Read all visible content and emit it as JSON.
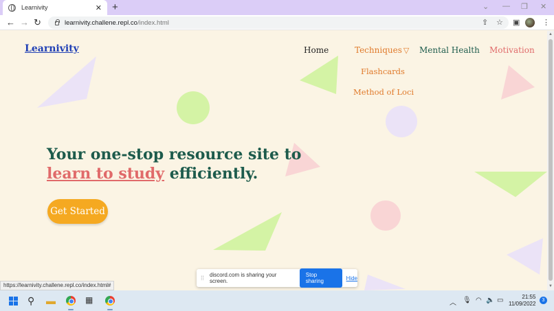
{
  "browser": {
    "tab_title": "Learnivity",
    "url_host": "learnivity.challene.repl.co",
    "url_path": "/index.html",
    "close_glyph": "✕",
    "new_tab_glyph": "+"
  },
  "site": {
    "logo": "Learnivity",
    "nav": {
      "home": "Home",
      "techniques": "Techniques",
      "mental_health": "Mental Health",
      "motivation": "Motivation"
    },
    "dropdown": [
      "Flashcards",
      "Method of Loci"
    ],
    "hero": {
      "line1": "Your one-stop resource site to",
      "highlight": "learn to study",
      "line2_rest": " efficiently."
    },
    "cta": "Get Started"
  },
  "status_bar": {
    "link": "https://learnivity.challene.repl.co/index.html#"
  },
  "share_bar": {
    "message": "discord.com is sharing your screen.",
    "stop": "Stop sharing",
    "hide": "Hide"
  },
  "taskbar": {
    "time": "21:55",
    "date": "11/09/2022",
    "notifications": "3"
  },
  "colors": {
    "page_bg": "#fbf4e4",
    "heading_green": "#1d5b4c",
    "accent_orange": "#e07a2b",
    "accent_pink": "#e06a6a",
    "cta_yellow": "#f5a921",
    "logo_blue": "#1f3fb5",
    "tab_strip": "#dbcdf7"
  }
}
